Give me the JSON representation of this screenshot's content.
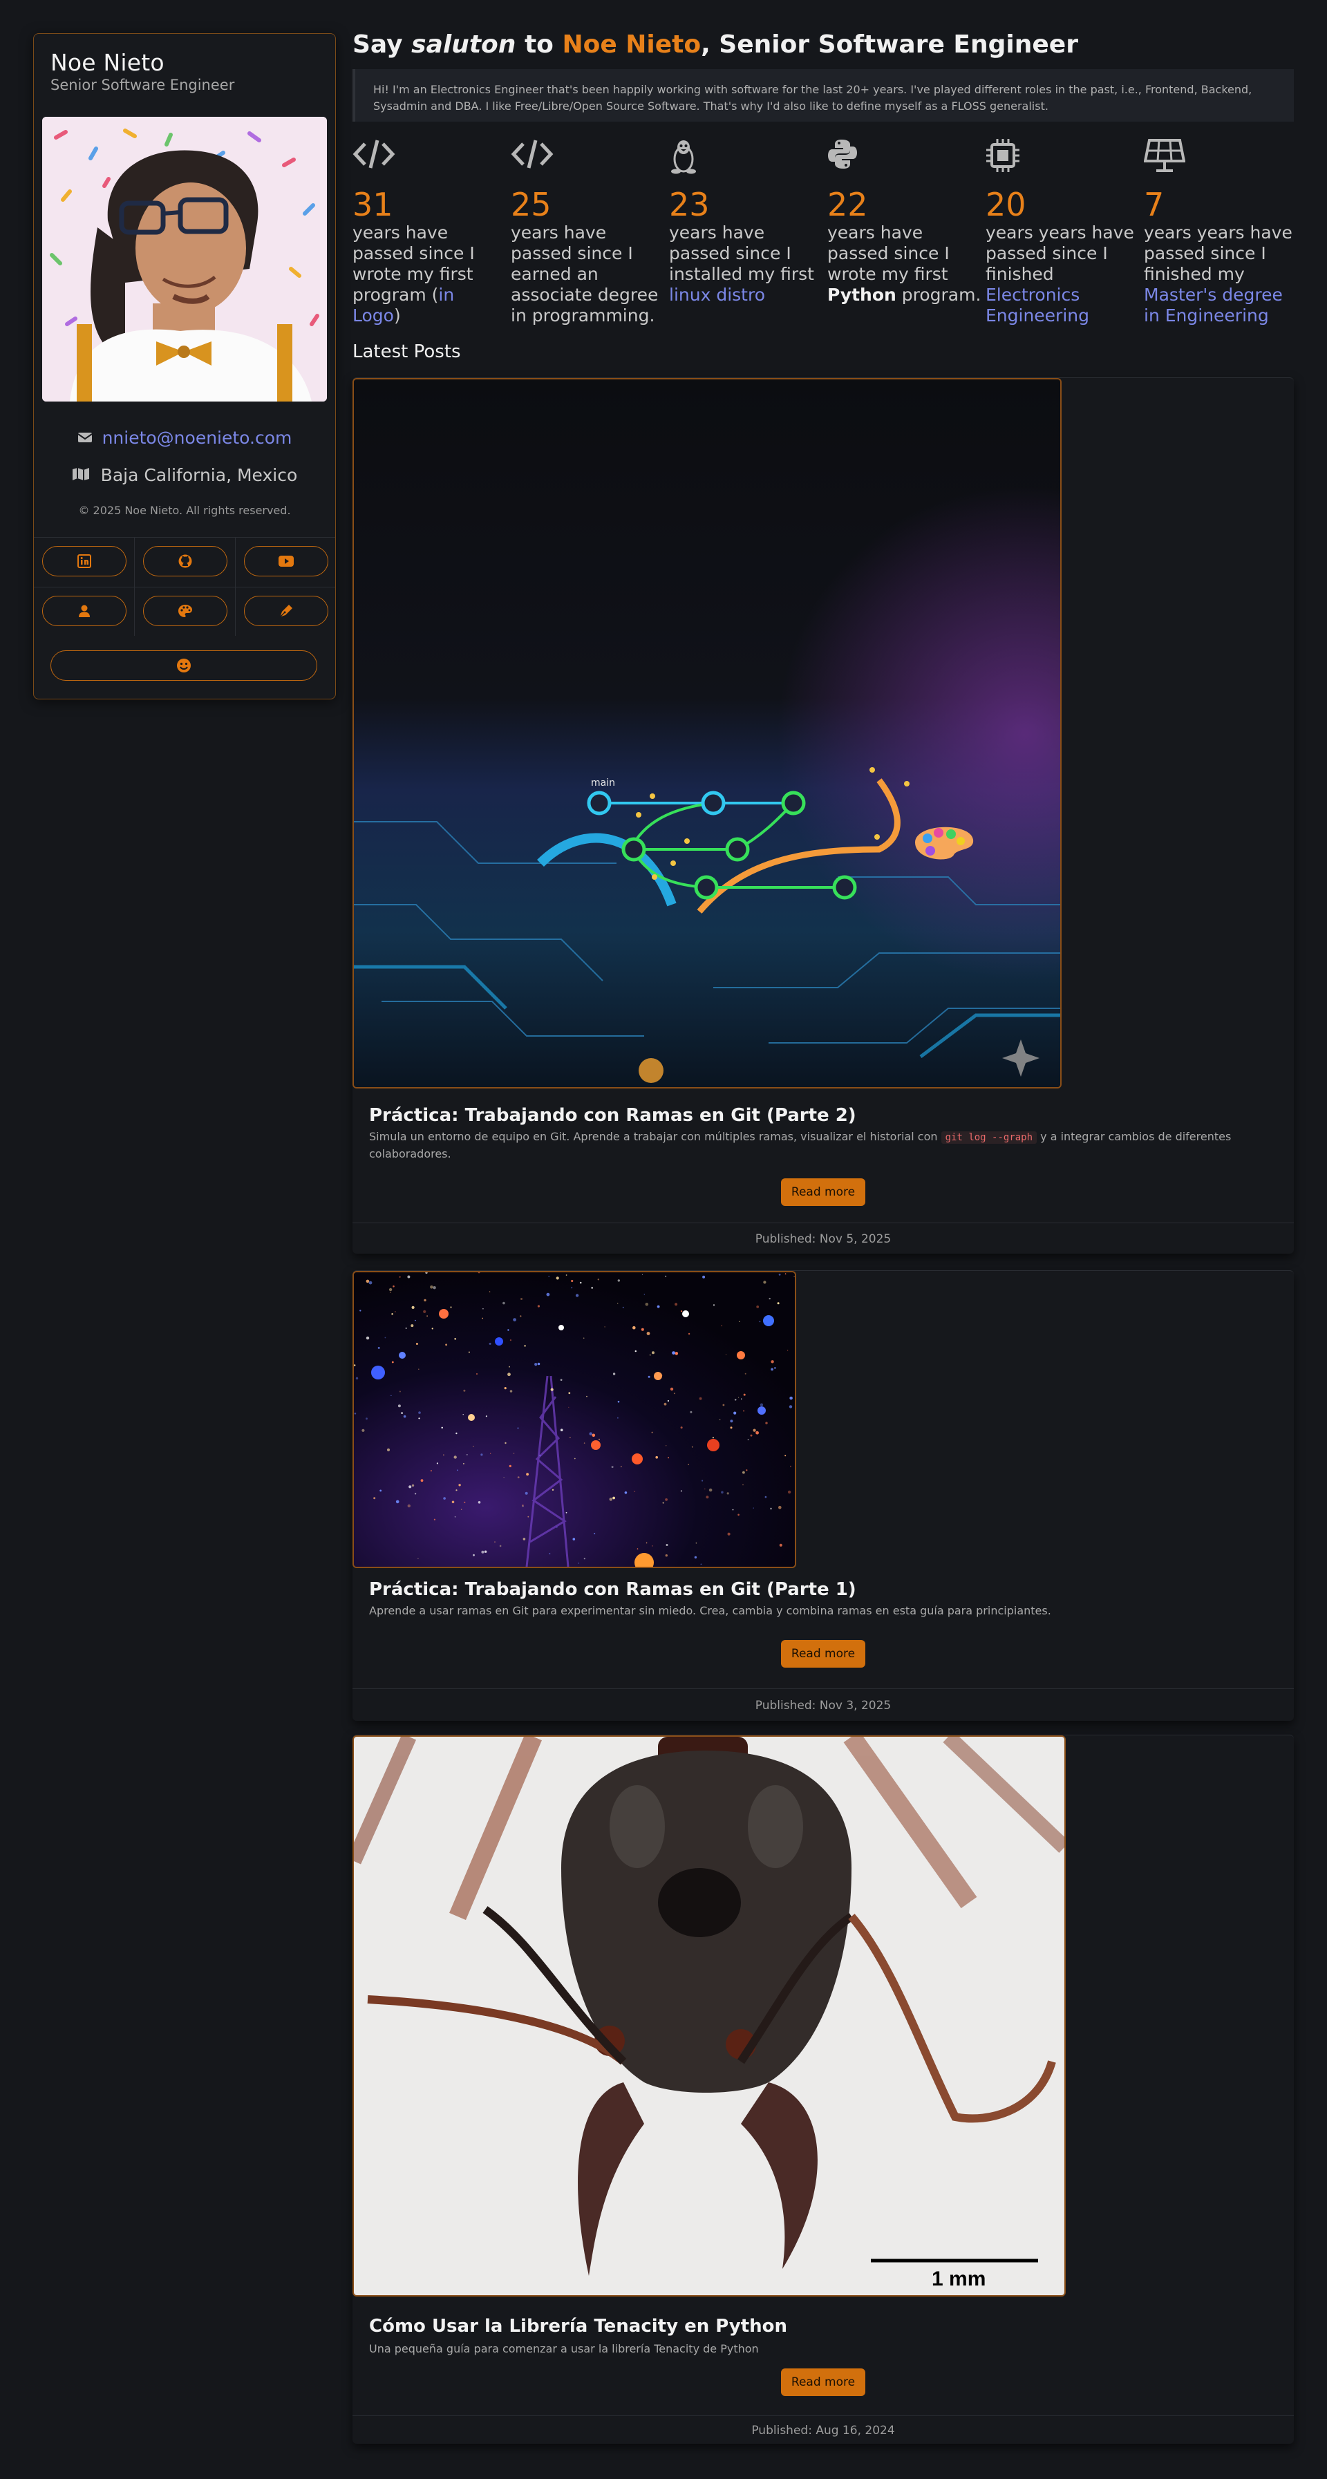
{
  "sidebar": {
    "name": "Noe Nieto",
    "role": "Senior Software Engineer",
    "email": "nnieto@noenieto.com",
    "location": "Baja California, Mexico",
    "copyright": "© 2025 Noe Nieto. All rights reserved.",
    "social_icons": [
      "linkedin-icon",
      "github-icon",
      "youtube-icon",
      "user-icon",
      "palette-icon",
      "pen-icon",
      "smile-icon"
    ]
  },
  "header": {
    "say": "Say",
    "greeting": "saluton",
    "to": "to",
    "name": "Noe Nieto",
    "role_suffix": ", Senior Software Engineer",
    "intro": "Hi! I'm an Electronics Engineer that's been happily working with software for the last 20+ years. I've played different roles in the past, i.e., Frontend, Backend, Sysadmin and DBA. I like Free/Libre/Open Source Software. That's why I'd also like to define myself as a FLOSS generalist."
  },
  "stats": [
    {
      "icon": "code-icon",
      "value": "31",
      "text_before": "years have passed since I wrote my first program (",
      "link": "in Logo",
      "text_after": ")"
    },
    {
      "icon": "code-icon",
      "value": "25",
      "text_before": "years have passed since I earned an associate degree in programming.",
      "link": "",
      "text_after": ""
    },
    {
      "icon": "linux-icon",
      "value": "23",
      "text_before": "years have passed since I installed my first ",
      "link": "linux distro",
      "text_after": ""
    },
    {
      "icon": "python-icon",
      "value": "22",
      "text_before": "years have passed since I wrote my first ",
      "bold": "Python",
      "text_after": " program."
    },
    {
      "icon": "chip-icon",
      "value": "20",
      "text_before": "years years have passed since I finished ",
      "link": "Electronics Engineering",
      "text_after": ""
    },
    {
      "icon": "solar-panel-icon",
      "value": "7",
      "text_before": "years years have passed since I finished my ",
      "link": "Master's degree in Engineering",
      "text_after": ""
    }
  ],
  "latest_posts_label": "Latest Posts",
  "posts": [
    {
      "title": "Práctica: Trabajando con Ramas en Git (Parte 2)",
      "desc_before": "Simula un entorno de equipo en Git. Aprende a trabajar con múltiples ramas, visualizar el historial con ",
      "desc_code": "git log --graph",
      "desc_after": " y a integrar cambios de diferentes colaboradores.",
      "branch_label": "main",
      "read_more": "Read more",
      "published": "Published: Nov 5, 2025"
    },
    {
      "title": "Práctica: Trabajando con Ramas en Git (Parte 1)",
      "desc": "Aprende a usar ramas en Git para experimentar sin miedo. Crea, cambia y combina ramas en esta guía para principiantes.",
      "read_more": "Read more",
      "published": "Published: Nov 3, 2025"
    },
    {
      "title": "Cómo Usar la Librería Tenacity en Python",
      "desc": "Una pequeña guía para comenzar a usar la librería Tenacity de Python",
      "scale_label": "1 mm",
      "read_more": "Read more",
      "published": "Published: Aug 16, 2024"
    }
  ],
  "colors": {
    "accent": "#e8811a",
    "link": "#7b87e6",
    "background": "#15171b"
  }
}
